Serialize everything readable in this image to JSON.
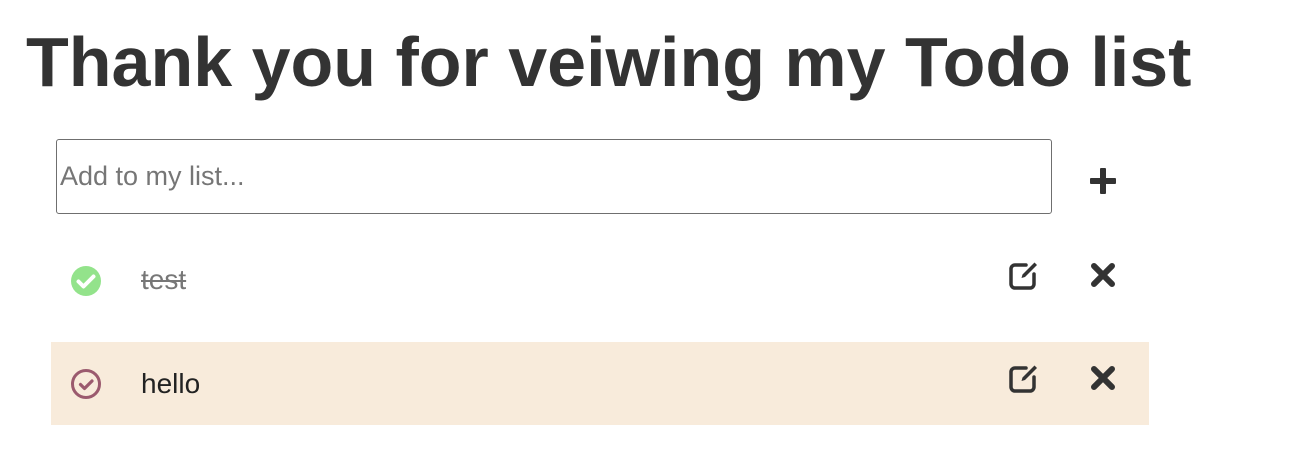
{
  "page": {
    "title": "Thank you for veiwing my Todo list"
  },
  "add_form": {
    "placeholder": "Add to my list...",
    "value": "",
    "add_icon": "plus-icon"
  },
  "todos": [
    {
      "text": "test",
      "completed": true,
      "check_icon": "check-circle-filled-icon",
      "check_color": "#93e38b",
      "edit_icon": "edit-icon",
      "delete_icon": "close-icon",
      "row_background": "#ffffff"
    },
    {
      "text": "hello",
      "completed": false,
      "check_icon": "check-circle-outline-icon",
      "check_color": "#9b5a6e",
      "edit_icon": "edit-icon",
      "delete_icon": "close-icon",
      "row_background": "#f8ebdb"
    }
  ],
  "colors": {
    "text": "#333333",
    "icon": "#333333",
    "highlight_row": "#f8ebdb",
    "completed_check": "#93e38b",
    "pending_check": "#9b5a6e"
  }
}
